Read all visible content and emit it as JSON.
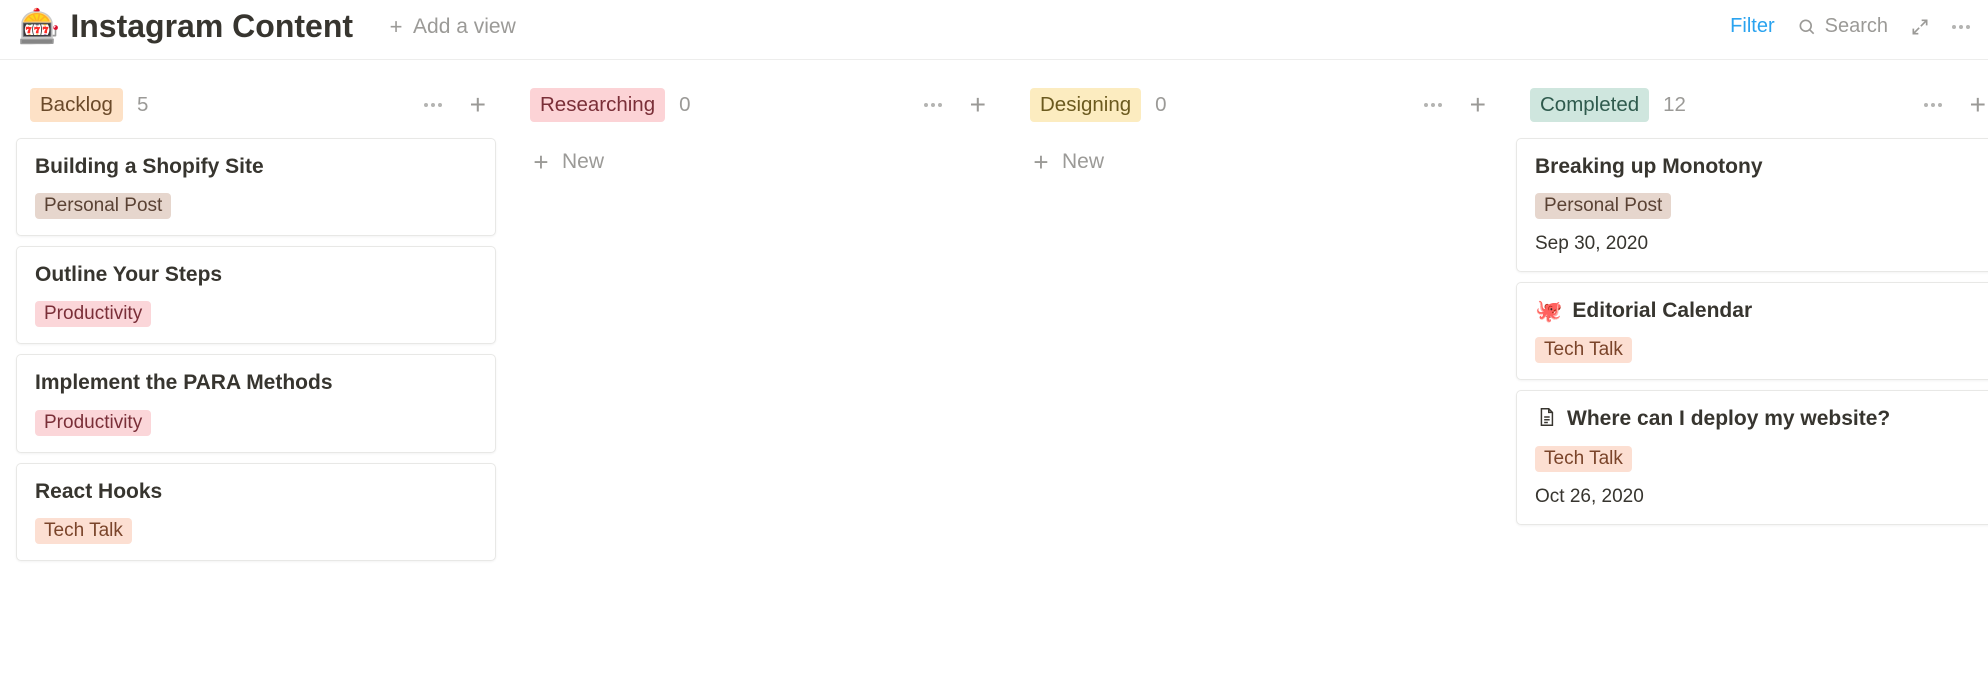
{
  "header": {
    "emoji": "🎰",
    "title": "Instagram Content",
    "add_view_label": "Add a view",
    "filter_label": "Filter",
    "search_label": "Search"
  },
  "new_label": "New",
  "tag_colors": {
    "Personal Post": "tag-brown",
    "Productivity": "tag-pink-lt",
    "Tech Talk": "tag-orange-lt"
  },
  "column_colors": {
    "Backlog": "tag-orange",
    "Researching": "tag-pink",
    "Designing": "tag-yellow",
    "Completed": "tag-green"
  },
  "columns": [
    {
      "name": "Backlog",
      "count": "5",
      "cards": [
        {
          "title": "Building a Shopify Site",
          "tag": "Personal Post"
        },
        {
          "title": "Outline Your Steps",
          "tag": "Productivity"
        },
        {
          "title": "Implement the PARA Methods",
          "tag": "Productivity"
        },
        {
          "title": "React Hooks",
          "tag": "Tech Talk"
        }
      ]
    },
    {
      "name": "Researching",
      "count": "0",
      "cards": [],
      "show_new": true
    },
    {
      "name": "Designing",
      "count": "0",
      "cards": [],
      "show_new": true
    },
    {
      "name": "Completed",
      "count": "12",
      "cards": [
        {
          "title": "Breaking up Monotony",
          "tag": "Personal Post",
          "date": "Sep 30, 2020"
        },
        {
          "icon_emoji": "🐙",
          "title": "Editorial Calendar",
          "tag": "Tech Talk"
        },
        {
          "icon_page": true,
          "title": "Where can I deploy my website?",
          "tag": "Tech Talk",
          "date": "Oct 26, 2020"
        }
      ]
    }
  ]
}
